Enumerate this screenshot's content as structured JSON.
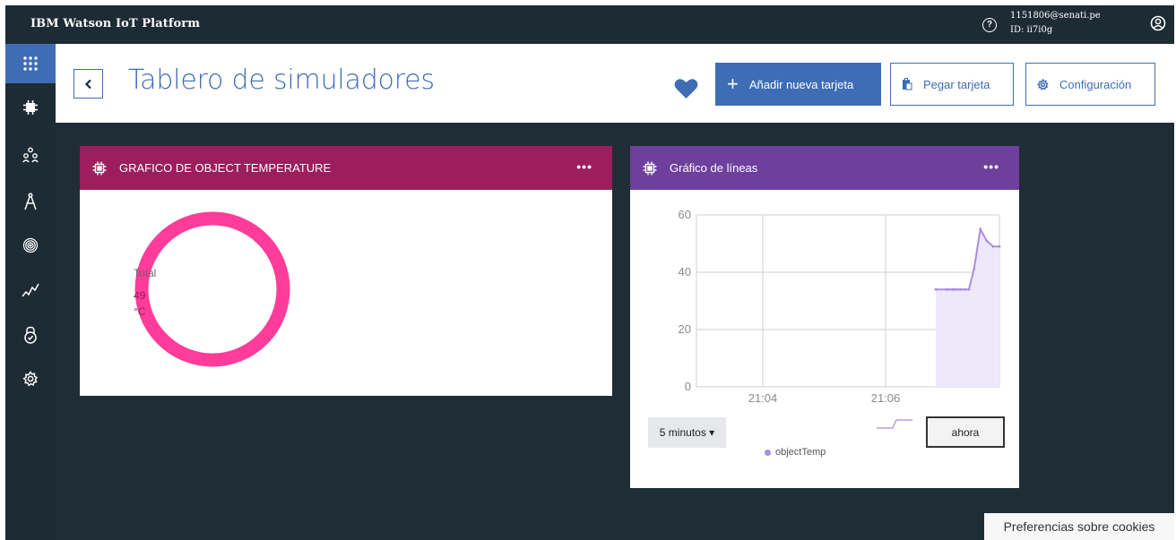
{
  "topbar": {
    "brand": "IBM Watson IoT Platform",
    "help_label": "?",
    "user_email": "1151806@senati.pe",
    "user_id": "ID: ii7i0g"
  },
  "rail": {
    "items": [
      "apps-icon",
      "devices-icon",
      "members-icon",
      "rules-icon",
      "security-icon",
      "usage-icon",
      "lock-icon",
      "settings-icon"
    ],
    "active_color": "#3f6db5"
  },
  "header": {
    "title": "Tablero de simuladores",
    "add_card_label": "Añadir nueva tarjeta",
    "add_plus": "+",
    "paste_card_label": "Pegar tarjeta",
    "config_label": "Configuración"
  },
  "card1": {
    "title": "GRAFICO DE OBJECT TEMPERATURE",
    "more": "•••",
    "total_label": "Total",
    "value": "49",
    "unit": "°C",
    "header_color": "#9c1e5c",
    "ring_color": "#ff3c9a"
  },
  "card2": {
    "title": "Gráfico de líneas",
    "more": "•••",
    "header_color": "#6e3f9c",
    "range_label": "5 minutos ▾",
    "now_label": "ahora",
    "legend_label": "objectTemp"
  },
  "chart_data": {
    "type": "line",
    "x_tick_labels": [
      "21:04",
      "21:06"
    ],
    "y_ticks": [
      0,
      20,
      40,
      60
    ],
    "ylim": [
      0,
      60
    ],
    "grid": true,
    "series": [
      {
        "name": "objectTemp",
        "color": "#a98fe0",
        "x": [
          0.0,
          0.16,
          0.2,
          0.26,
          0.28,
          0.32,
          0.36,
          0.4,
          0.46,
          0.52,
          0.6,
          0.7,
          0.8,
          0.9,
          1.0
        ],
        "values": [
          34,
          34,
          34,
          34,
          34,
          34,
          34,
          34,
          34,
          34,
          41,
          55,
          51,
          49,
          49
        ]
      }
    ]
  },
  "footer": {
    "cookies_label": "Preferencias sobre cookies"
  }
}
